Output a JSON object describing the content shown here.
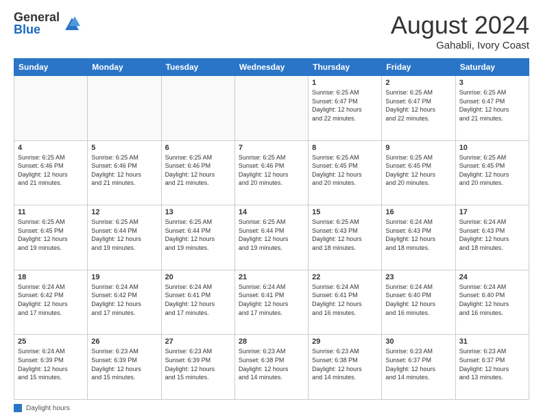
{
  "header": {
    "logo": {
      "general": "General",
      "blue": "Blue"
    },
    "title": "August 2024",
    "subtitle": "Gahabli, Ivory Coast"
  },
  "calendar": {
    "days_of_week": [
      "Sunday",
      "Monday",
      "Tuesday",
      "Wednesday",
      "Thursday",
      "Friday",
      "Saturday"
    ],
    "weeks": [
      [
        {
          "day": "",
          "info": ""
        },
        {
          "day": "",
          "info": ""
        },
        {
          "day": "",
          "info": ""
        },
        {
          "day": "",
          "info": ""
        },
        {
          "day": "1",
          "info": "Sunrise: 6:25 AM\nSunset: 6:47 PM\nDaylight: 12 hours\nand 22 minutes."
        },
        {
          "day": "2",
          "info": "Sunrise: 6:25 AM\nSunset: 6:47 PM\nDaylight: 12 hours\nand 22 minutes."
        },
        {
          "day": "3",
          "info": "Sunrise: 6:25 AM\nSunset: 6:47 PM\nDaylight: 12 hours\nand 21 minutes."
        }
      ],
      [
        {
          "day": "4",
          "info": "Sunrise: 6:25 AM\nSunset: 6:46 PM\nDaylight: 12 hours\nand 21 minutes."
        },
        {
          "day": "5",
          "info": "Sunrise: 6:25 AM\nSunset: 6:46 PM\nDaylight: 12 hours\nand 21 minutes."
        },
        {
          "day": "6",
          "info": "Sunrise: 6:25 AM\nSunset: 6:46 PM\nDaylight: 12 hours\nand 21 minutes."
        },
        {
          "day": "7",
          "info": "Sunrise: 6:25 AM\nSunset: 6:46 PM\nDaylight: 12 hours\nand 20 minutes."
        },
        {
          "day": "8",
          "info": "Sunrise: 6:25 AM\nSunset: 6:45 PM\nDaylight: 12 hours\nand 20 minutes."
        },
        {
          "day": "9",
          "info": "Sunrise: 6:25 AM\nSunset: 6:45 PM\nDaylight: 12 hours\nand 20 minutes."
        },
        {
          "day": "10",
          "info": "Sunrise: 6:25 AM\nSunset: 6:45 PM\nDaylight: 12 hours\nand 20 minutes."
        }
      ],
      [
        {
          "day": "11",
          "info": "Sunrise: 6:25 AM\nSunset: 6:45 PM\nDaylight: 12 hours\nand 19 minutes."
        },
        {
          "day": "12",
          "info": "Sunrise: 6:25 AM\nSunset: 6:44 PM\nDaylight: 12 hours\nand 19 minutes."
        },
        {
          "day": "13",
          "info": "Sunrise: 6:25 AM\nSunset: 6:44 PM\nDaylight: 12 hours\nand 19 minutes."
        },
        {
          "day": "14",
          "info": "Sunrise: 6:25 AM\nSunset: 6:44 PM\nDaylight: 12 hours\nand 19 minutes."
        },
        {
          "day": "15",
          "info": "Sunrise: 6:25 AM\nSunset: 6:43 PM\nDaylight: 12 hours\nand 18 minutes."
        },
        {
          "day": "16",
          "info": "Sunrise: 6:24 AM\nSunset: 6:43 PM\nDaylight: 12 hours\nand 18 minutes."
        },
        {
          "day": "17",
          "info": "Sunrise: 6:24 AM\nSunset: 6:43 PM\nDaylight: 12 hours\nand 18 minutes."
        }
      ],
      [
        {
          "day": "18",
          "info": "Sunrise: 6:24 AM\nSunset: 6:42 PM\nDaylight: 12 hours\nand 17 minutes."
        },
        {
          "day": "19",
          "info": "Sunrise: 6:24 AM\nSunset: 6:42 PM\nDaylight: 12 hours\nand 17 minutes."
        },
        {
          "day": "20",
          "info": "Sunrise: 6:24 AM\nSunset: 6:41 PM\nDaylight: 12 hours\nand 17 minutes."
        },
        {
          "day": "21",
          "info": "Sunrise: 6:24 AM\nSunset: 6:41 PM\nDaylight: 12 hours\nand 17 minutes."
        },
        {
          "day": "22",
          "info": "Sunrise: 6:24 AM\nSunset: 6:41 PM\nDaylight: 12 hours\nand 16 minutes."
        },
        {
          "day": "23",
          "info": "Sunrise: 6:24 AM\nSunset: 6:40 PM\nDaylight: 12 hours\nand 16 minutes."
        },
        {
          "day": "24",
          "info": "Sunrise: 6:24 AM\nSunset: 6:40 PM\nDaylight: 12 hours\nand 16 minutes."
        }
      ],
      [
        {
          "day": "25",
          "info": "Sunrise: 6:24 AM\nSunset: 6:39 PM\nDaylight: 12 hours\nand 15 minutes."
        },
        {
          "day": "26",
          "info": "Sunrise: 6:23 AM\nSunset: 6:39 PM\nDaylight: 12 hours\nand 15 minutes."
        },
        {
          "day": "27",
          "info": "Sunrise: 6:23 AM\nSunset: 6:39 PM\nDaylight: 12 hours\nand 15 minutes."
        },
        {
          "day": "28",
          "info": "Sunrise: 6:23 AM\nSunset: 6:38 PM\nDaylight: 12 hours\nand 14 minutes."
        },
        {
          "day": "29",
          "info": "Sunrise: 6:23 AM\nSunset: 6:38 PM\nDaylight: 12 hours\nand 14 minutes."
        },
        {
          "day": "30",
          "info": "Sunrise: 6:23 AM\nSunset: 6:37 PM\nDaylight: 12 hours\nand 14 minutes."
        },
        {
          "day": "31",
          "info": "Sunrise: 6:23 AM\nSunset: 6:37 PM\nDaylight: 12 hours\nand 13 minutes."
        }
      ]
    ]
  },
  "footer": {
    "daylight_label": "Daylight hours"
  }
}
